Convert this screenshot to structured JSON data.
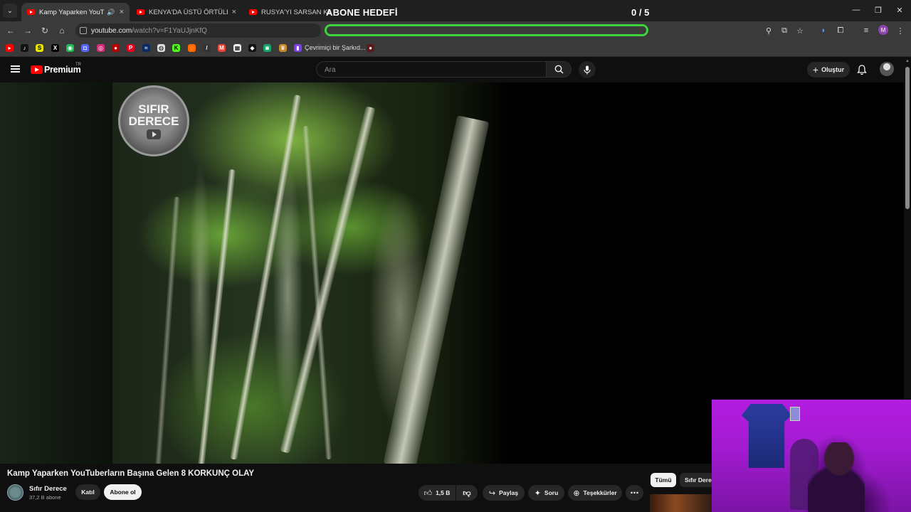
{
  "browser": {
    "tabs": [
      {
        "title": "Kamp Yaparken YouTuberları",
        "active": true,
        "audio": true
      },
      {
        "title": "KENYA'DA ÜSTÜ ÖRTÜLEN KOR",
        "active": false,
        "audio": false
      },
      {
        "title": "RUSYA'YI SARSAN KARANLIK",
        "active": false,
        "audio": false
      }
    ],
    "close_glyph": "×",
    "address": {
      "host": "youtube.com",
      "path": "/watch?v=F1YaUJjnKfQ"
    },
    "profile_initial": "M",
    "bookmark_folder": "Çevrimiçi bir Şarkıd..."
  },
  "overlay": {
    "title": "ABONE HEDEFİ",
    "count": "0 / 5",
    "progress": 0
  },
  "youtube": {
    "logo_text": "Premium",
    "country_code": "TR",
    "search_placeholder": "Ara",
    "create_label": "Oluştur"
  },
  "video": {
    "watermark_line1": "SIFIR",
    "watermark_line2": "DERECE",
    "title": "Kamp Yaparken YouTuberların Başına Gelen 8 KORKUNÇ OLAY"
  },
  "channel": {
    "name": "Sıfır Derece",
    "subscribers": "37,2 B abone",
    "join_label": "Katıl",
    "subscribe_label": "Abone ol"
  },
  "actions": {
    "like_count": "1,5 B",
    "share_label": "Paylaş",
    "ask_label": "Soru",
    "thanks_label": "Teşekkürler"
  },
  "chips": {
    "all": "Tümü",
    "channel": "Sıfır Derec"
  },
  "colors": {
    "accent_red": "#ff0000",
    "progress_border": "#3fd33f",
    "webcam_purple": "#b31de0"
  }
}
